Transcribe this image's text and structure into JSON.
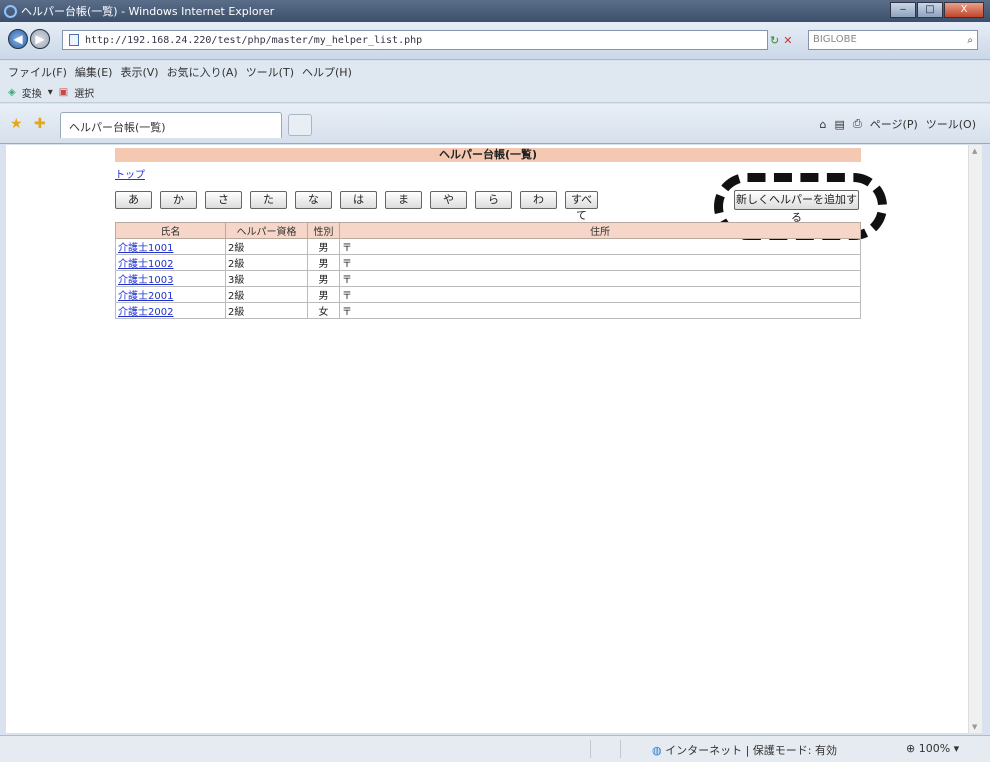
{
  "window": {
    "title": "ヘルパー台帳(一覧) - Windows Internet Explorer"
  },
  "address": {
    "url": "http://192.168.24.220/test/php/master/my_helper_list.php",
    "search_placeholder": "BIGLOBE"
  },
  "menu": [
    "ファイル(F)",
    "編集(E)",
    "表示(V)",
    "お気に入り(A)",
    "ツール(T)",
    "ヘルプ(H)"
  ],
  "links": {
    "convert": "変換",
    "select": "選択"
  },
  "tab": {
    "label": "ヘルパー台帳(一覧)"
  },
  "commands": {
    "page": "ページ(P)",
    "tools": "ツール(O)"
  },
  "page": {
    "title": "ヘルパー台帳(一覧)",
    "top_link": "トップ",
    "kana": [
      "あ",
      "か",
      "さ",
      "た",
      "な",
      "は",
      "ま",
      "や",
      "ら",
      "わ"
    ],
    "all_button": "すべて",
    "add_button": "新しくヘルパーを追加する",
    "columns": [
      "氏名",
      "ヘルパー資格",
      "性別",
      "住所"
    ],
    "rows": [
      {
        "name": "介護士1001",
        "qual": "2級",
        "sex": "男",
        "addr": "〒"
      },
      {
        "name": "介護士1002",
        "qual": "2級",
        "sex": "男",
        "addr": "〒"
      },
      {
        "name": "介護士1003",
        "qual": "3級",
        "sex": "男",
        "addr": "〒"
      },
      {
        "name": "介護士2001",
        "qual": "2級",
        "sex": "男",
        "addr": "〒"
      },
      {
        "name": "介護士2002",
        "qual": "2級",
        "sex": "女",
        "addr": "〒"
      }
    ]
  },
  "status": {
    "zone": "インターネット | 保護モード: 有効",
    "zoom": "100%"
  }
}
